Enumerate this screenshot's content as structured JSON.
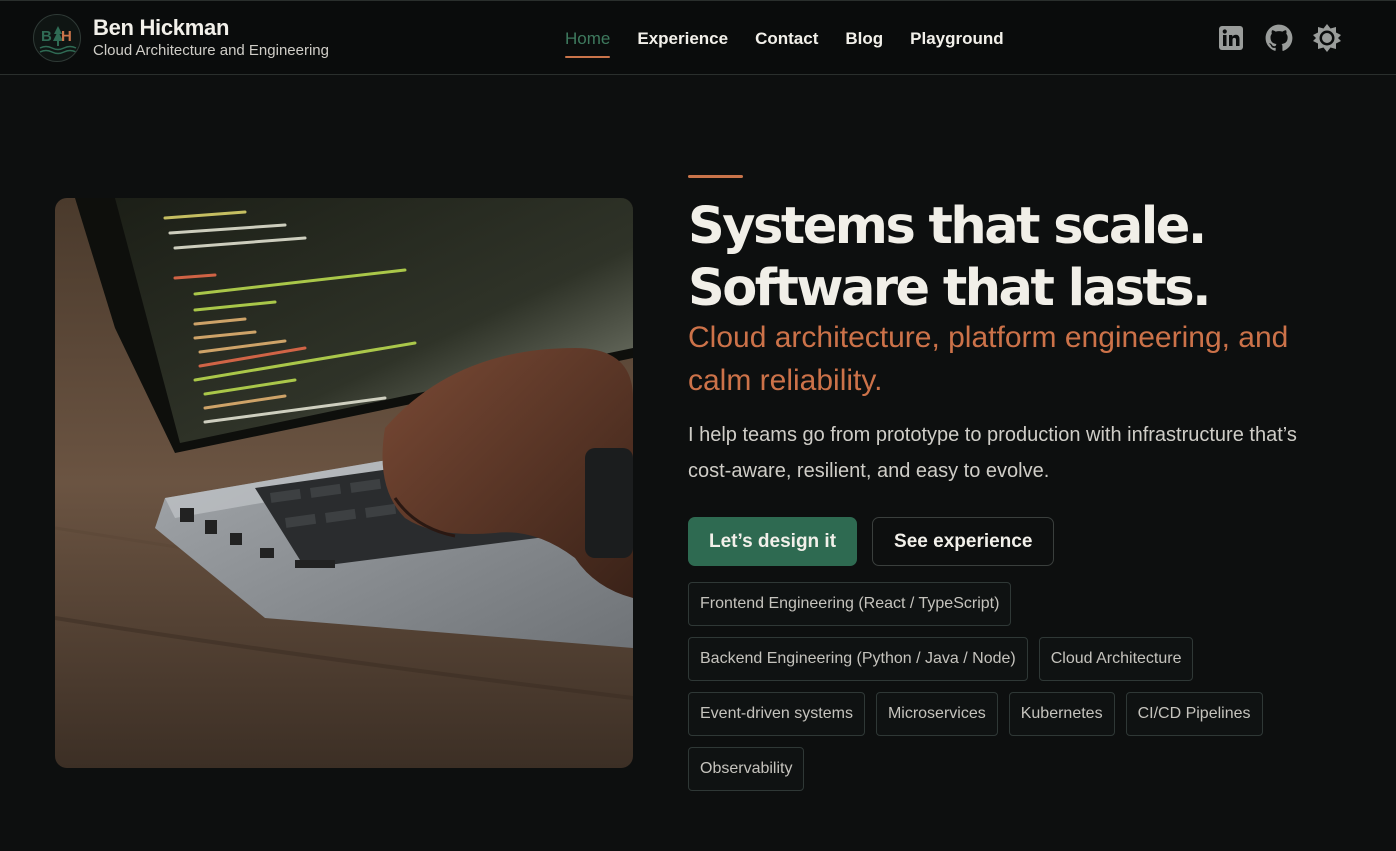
{
  "header": {
    "logo_text": "BH",
    "name": "Ben Hickman",
    "tagline": "Cloud Architecture and Engineering",
    "nav": [
      {
        "label": "Home",
        "active": true
      },
      {
        "label": "Experience",
        "active": false
      },
      {
        "label": "Contact",
        "active": false
      },
      {
        "label": "Blog",
        "active": false
      },
      {
        "label": "Playground",
        "active": false
      }
    ],
    "icons": [
      "linkedin-icon",
      "github-icon",
      "theme-toggle-icon"
    ]
  },
  "hero": {
    "headline_line1": "Systems that scale.",
    "headline_line2": "Software that lasts.",
    "subhead": "Cloud architecture, platform engineering, and calm reliability.",
    "lede": "I help teams go from prototype to production with infrastructure that’s cost-aware, resilient, and easy to evolve.",
    "primary_cta": "Let’s design it",
    "secondary_cta": "See experience",
    "skills": [
      "Frontend Engineering (React / TypeScript)",
      "Backend Engineering (Python / Java / Node)",
      "Cloud Architecture",
      "Event-driven systems",
      "Microservices",
      "Kubernetes",
      "CI/CD Pipelines",
      "Observability"
    ]
  },
  "colors": {
    "background": "#0d0f0f",
    "accent_orange": "#cc7249",
    "accent_green": "#2e6a51",
    "text": "#f1efe8"
  }
}
